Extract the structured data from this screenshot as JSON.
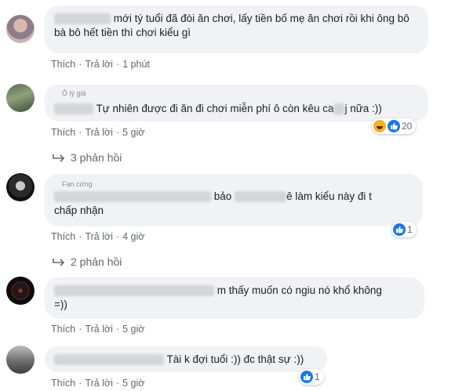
{
  "comments": [
    {
      "text": "mới tý tuổi đã đòi ăn chơi, lấy tiền bố mẹ ăn chơi rồi khi ông bô bà bô hết tiền thì chơi kiểu gì",
      "actions": {
        "like": "Thích",
        "reply": "Trả lời",
        "time": "1 phút"
      }
    },
    {
      "tag": "Ô lý giả",
      "text_a": "Tự nhiên được đi ăn đi chơi miễn phí ô còn kêu ca",
      "text_b": "j nữa :))",
      "reaction_count": "20",
      "actions": {
        "like": "Thích",
        "reply": "Trả lời",
        "time": "5 giờ"
      },
      "replies": "3 phản hồi"
    },
    {
      "tag": "Fan cứng",
      "text_a": "bảo",
      "text_b": "ê làm kiểu này đi t",
      "text_c": "chấp nhận",
      "reaction_count": "1",
      "actions": {
        "like": "Thích",
        "reply": "Trả lời",
        "time": "4 giờ"
      },
      "replies": "2 phản hồi"
    },
    {
      "text_a": "m thấy muốn có ngiu nó khổ không",
      "text_b": "=))",
      "actions": {
        "like": "Thích",
        "reply": "Trả lời",
        "time": "5 giờ"
      }
    },
    {
      "text": "Tài k đợi tuổi :)) đc thật sự :))",
      "reaction_count": "1",
      "actions": {
        "like": "Thích",
        "reply": "Trả lời",
        "time": "5 giờ"
      }
    }
  ],
  "separator": "·",
  "colors": {
    "bubble": "#f0f2f5",
    "meta": "#65676b",
    "like_blue": "#1877f2",
    "haha_yellow": "#f7b125"
  }
}
